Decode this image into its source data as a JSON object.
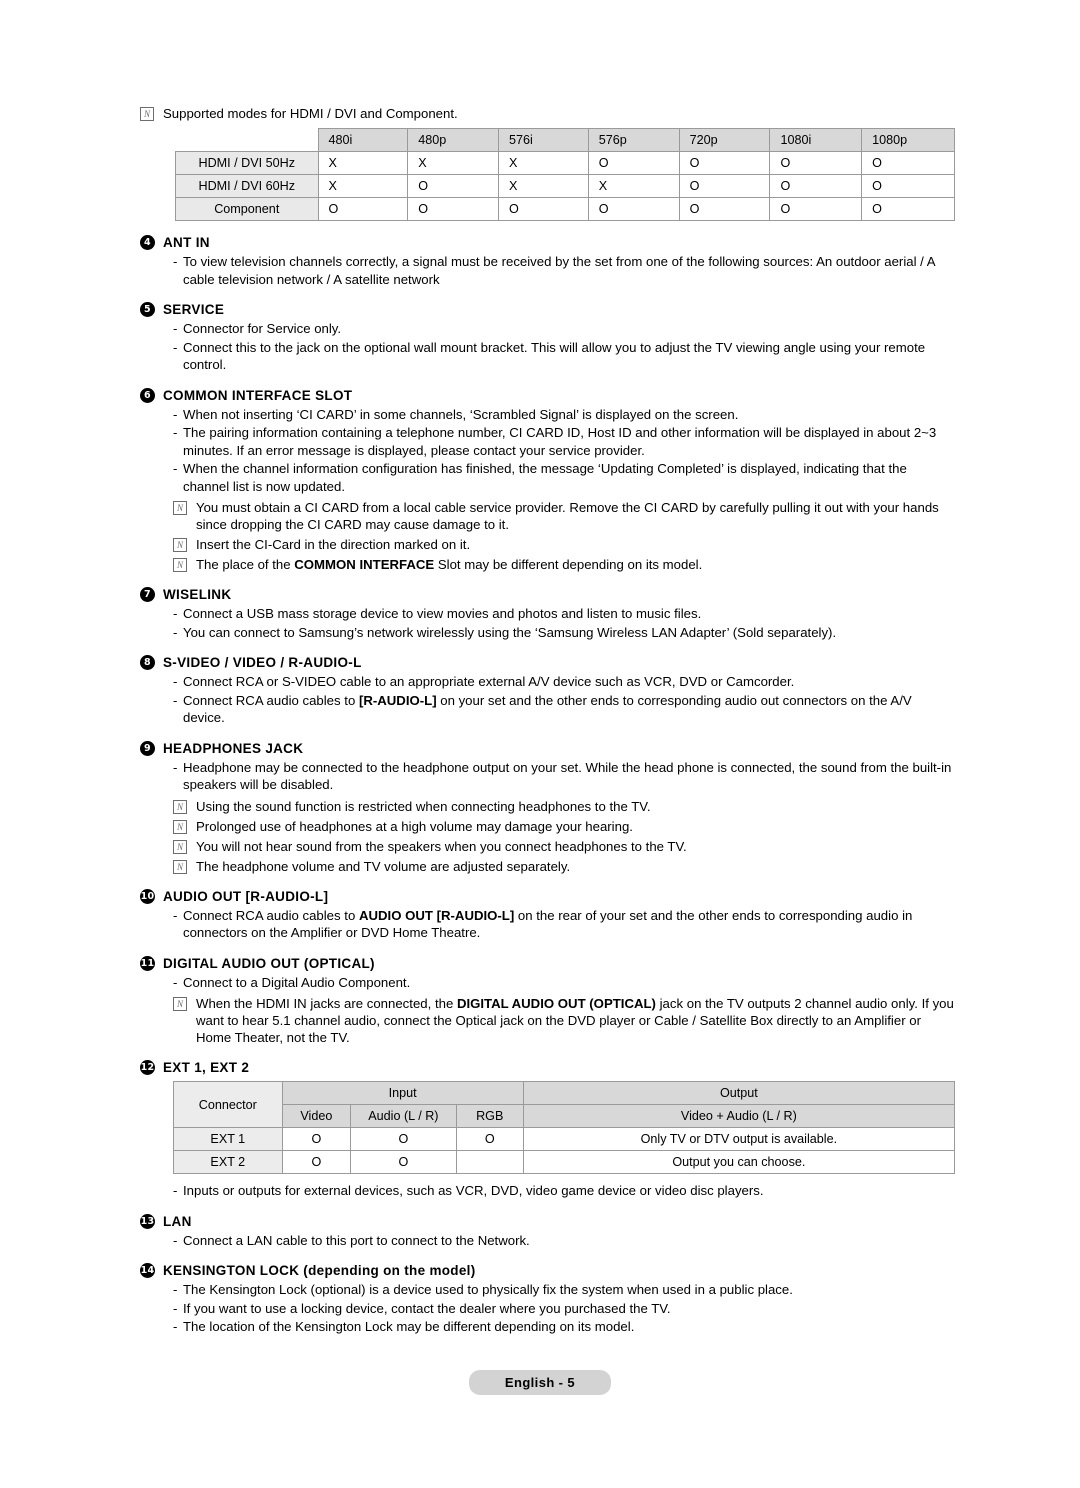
{
  "top_note": {
    "icon": "note-icon",
    "text": "Supported modes for HDMI / DVI and Component."
  },
  "modes_table": {
    "columns": [
      "",
      "480i",
      "480p",
      "576i",
      "576p",
      "720p",
      "1080i",
      "1080p"
    ],
    "rows": [
      {
        "label": "HDMI / DVI 50Hz",
        "values": [
          "X",
          "X",
          "X",
          "O",
          "O",
          "O",
          "O"
        ]
      },
      {
        "label": "HDMI / DVI 60Hz",
        "values": [
          "X",
          "O",
          "X",
          "X",
          "O",
          "O",
          "O"
        ]
      },
      {
        "label": "Component",
        "values": [
          "O",
          "O",
          "O",
          "O",
          "O",
          "O",
          "O"
        ]
      }
    ]
  },
  "sections": [
    {
      "num": "4",
      "title": "ANT IN",
      "bullets": [
        "To view television channels correctly, a signal must be received by the set from one of the following sources: An outdoor aerial / A cable television network / A satellite network"
      ],
      "notes": []
    },
    {
      "num": "5",
      "title": "SERVICE",
      "bullets": [
        "Connector for Service only.",
        "Connect this to the jack on the optional wall mount bracket. This will allow you to adjust the TV viewing angle using your remote control."
      ],
      "notes": []
    },
    {
      "num": "6",
      "title": "COMMON INTERFACE SLOT",
      "bullets": [
        "When not inserting ‘CI CARD’ in some channels, ‘Scrambled Signal’ is displayed on the screen.",
        "The pairing information containing a telephone number, CI CARD ID, Host ID and other information will be displayed in about 2~3 minutes. If an error message is displayed, please contact your service provider.",
        "When the channel information configuration has finished, the message ‘Updating Completed’ is displayed, indicating that the channel list is now updated."
      ],
      "notes": [
        "You must obtain a CI CARD from a local cable service provider. Remove the CI CARD by carefully pulling it out with your hands since dropping the CI CARD may cause damage to it.",
        "Insert the CI-Card in the direction marked on it.",
        "The place of the COMMON INTERFACE Slot may be different depending on its model."
      ]
    },
    {
      "num": "7",
      "title": "WISELINK",
      "bullets": [
        "Connect a USB mass storage device to view movies and photos and listen to music files.",
        "You can connect to Samsung’s network wirelessly using the ‘Samsung Wireless LAN Adapter’ (Sold separately)."
      ],
      "notes": []
    },
    {
      "num": "8",
      "title": "S-VIDEO / VIDEO / R-AUDIO-L",
      "bullets": [
        "Connect RCA or S-VIDEO cable to an appropriate external A/V device such as VCR, DVD or Camcorder.",
        "Connect RCA audio cables to [R-AUDIO-L] on your set and the other ends to corresponding audio out connectors on the A/V device."
      ],
      "notes": []
    },
    {
      "num": "9",
      "title": "HEADPHONES JACK",
      "bullets": [
        "Headphone may be connected to the headphone output on your set. While the head phone is connected, the sound from the built-in speakers will be disabled."
      ],
      "notes": [
        "Using the sound function is restricted when connecting headphones to the TV.",
        "Prolonged use of headphones at a high volume may damage your hearing.",
        "You will not hear sound from the speakers when you connect headphones to the TV.",
        "The headphone volume and TV volume are adjusted separately."
      ]
    },
    {
      "num": "10",
      "title": "AUDIO OUT [R-AUDIO-L]",
      "bullets": [
        "Connect RCA audio cables to AUDIO OUT [R-AUDIO-L] on the rear of your set and the other ends to corresponding audio in connectors on the Amplifier or DVD Home Theatre."
      ],
      "notes": []
    },
    {
      "num": "11",
      "title": "DIGITAL AUDIO OUT (OPTICAL)",
      "bullets": [
        "Connect to a Digital Audio Component."
      ],
      "notes": [
        "When the HDMI IN jacks are connected, the DIGITAL AUDIO OUT (OPTICAL) jack on the TV outputs 2 channel audio only. If you want to hear 5.1 channel audio, connect the Optical jack on the DVD player or Cable / Satellite Box directly to an Amplifier or Home Theater, not the TV."
      ]
    }
  ],
  "ext_section": {
    "num": "12",
    "title": "EXT 1, EXT 2",
    "table": {
      "connector_label": "Connector",
      "input_label": "Input",
      "output_label": "Output",
      "sub_headers": [
        "Video",
        "Audio (L / R)",
        "RGB"
      ],
      "output_sub_header": "Video + Audio (L / R)",
      "rows": [
        {
          "name": "EXT 1",
          "video": "O",
          "audio": "O",
          "rgb": "O",
          "output": "Only TV or DTV output is available."
        },
        {
          "name": "EXT 2",
          "video": "O",
          "audio": "O",
          "rgb": "",
          "output": "Output you can choose."
        }
      ]
    },
    "bullets": [
      "Inputs or outputs for external devices, such as VCR, DVD, video game device or video disc players."
    ]
  },
  "sections_tail": [
    {
      "num": "13",
      "title": "LAN",
      "bullets": [
        "Connect a LAN cable to this port to connect to the Network."
      ],
      "notes": []
    },
    {
      "num": "14",
      "title": "KENSINGTON LOCK (depending on the model)",
      "bullets": [
        "The Kensington Lock (optional) is a device used to physically fix the system when used in a public place.",
        "If you want to use a locking device, contact the dealer where you purchased the TV.",
        "The location of the Kensington Lock may be different depending on its model."
      ],
      "notes": []
    }
  ],
  "footer": {
    "label": "English - 5"
  }
}
